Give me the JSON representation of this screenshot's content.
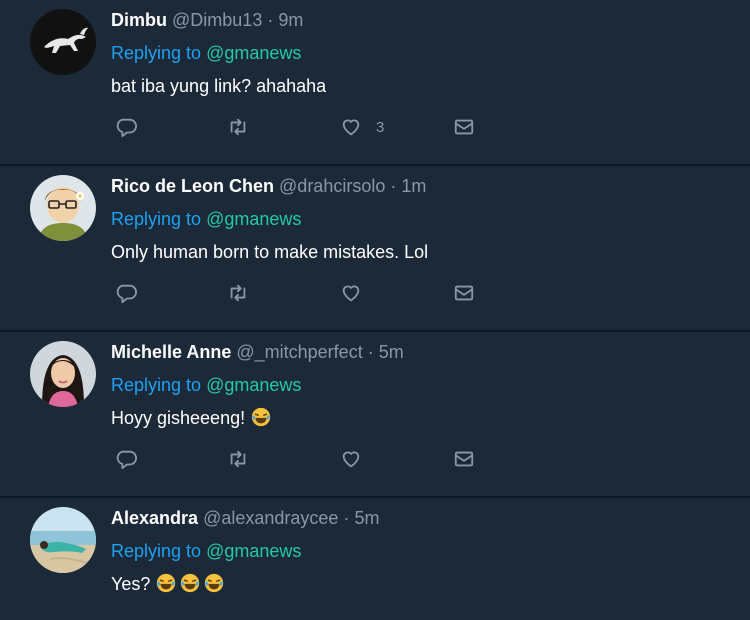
{
  "tweets": [
    {
      "name": "Dimbu",
      "handle": "@Dimbu13",
      "sep": "·",
      "time": "9m",
      "replying_label": "Replying to",
      "mention": "@gmanews",
      "text": "bat iba yung link? ahahaha",
      "like_count": "3",
      "avatar": "bull-logo-avatar"
    },
    {
      "name": "Rico de Leon Chen",
      "handle": "@drahcirsolo",
      "sep": "·",
      "time": "1m",
      "replying_label": "Replying to",
      "mention": "@gmanews",
      "text": "Only human born to make mistakes. Lol",
      "like_count": "",
      "avatar": "cartoon-man-avatar"
    },
    {
      "name": "Michelle Anne",
      "handle": "@_mitchperfect",
      "sep": "·",
      "time": "5m",
      "replying_label": "Replying to",
      "mention": "@gmanews",
      "text": "Hoyy gisheeeng!",
      "like_count": "",
      "avatar": "woman-photo-avatar"
    },
    {
      "name": "Alexandra",
      "handle": "@alexandraycee",
      "sep": "·",
      "time": "5m",
      "replying_label": "Replying to",
      "mention": "@gmanews",
      "text": "Yes?",
      "like_count": "",
      "avatar": "beach-photo-avatar"
    }
  ],
  "icons": {
    "reply": "reply-icon",
    "retweet": "retweet-icon",
    "like": "heart-icon",
    "dm": "envelope-icon",
    "emoji": "face-with-tears-of-joy-emoji"
  },
  "colors": {
    "background": "#1c2938",
    "divider": "#0f1822",
    "secondary_text": "#8899a6",
    "mention": "#22c9a8",
    "link_blue": "#1da1f2"
  }
}
